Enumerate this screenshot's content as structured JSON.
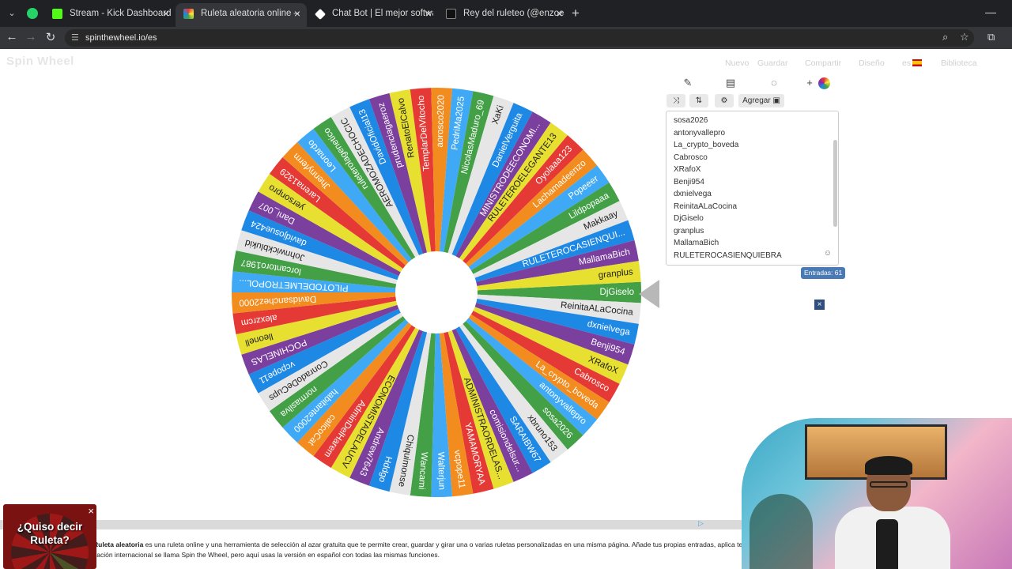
{
  "browser": {
    "tabs": [
      {
        "title": "Stream - Kick Dashboard",
        "favicon_color": "#53fc18"
      },
      {
        "title": "Ruleta aleatoria online – ruleta",
        "favicon_color": "#e53935"
      },
      {
        "title": "Chat Bot | El mejor software pa",
        "favicon_color": "#ffffff"
      },
      {
        "title": "Rey del ruleteo (@enzoeasycas",
        "favicon_color": "#111111"
      }
    ],
    "url": "spinthewheel.io/es"
  },
  "site": {
    "logo": "Spin Wheel",
    "menu": [
      "Nuevo",
      "Guardar",
      "Compartir",
      "Diseño",
      "es",
      "Biblioteca"
    ]
  },
  "wheel": {
    "colors": [
      "#43a047",
      "#e6e6e6",
      "#1e88e5",
      "#7b3f9e",
      "#e8e030",
      "#e53935",
      "#f28c1e",
      "#3fa9f5"
    ],
    "segments": [
      "DjGiselo",
      "ReinitaALaCocina",
      "dxnielvega",
      "Benji954",
      "XRafoX",
      "Cabrosco",
      "La_crypto_boveda",
      "antonyvallepro",
      "sosa2026",
      "xbruno153",
      "SARAIBW67",
      "comisiondelsur...",
      "ADMINISTRAORDELAS...",
      "YAMAMORYAA",
      "vcpope11",
      "Walterjun",
      "Wancami",
      "Chiquimonse",
      "Hddgo",
      "Andrew7643",
      "ECONOMISTADELAUCV",
      "AdminDelHarem",
      "calicoCat",
      "habitante2000",
      "normasilva",
      "ConradoDeCups",
      "vcpope11",
      "POCHINELAS",
      "lleonell",
      "alexzrcm",
      "Davidsanchez2000",
      "PILOTODELMETROPOL...",
      "lorcantoro1987",
      "Johnwickblukid",
      "davidjosue424",
      "Dani_007",
      "yersonpro",
      "Larena1329",
      "Jhennyferm",
      "Leonardo",
      "ruleterolagenetico",
      "AEROMOZADECHOCIC",
      "DavidOficial13",
      "prudenciagaeroz",
      "RenatoElCalvo",
      "TemplarDelVitocho",
      "aorosco2020",
      "PedriMa2025",
      "NicolasMaduro_69",
      "XaKi",
      "DanielVerguita",
      "MINISTRODEECONOMI...",
      "RULETEROELEGANTE13",
      "Oyolaaa123",
      "Lachamadeenzo",
      "Popeeer",
      "Lildpopaaa",
      "Makkaay",
      "RULETEROCASIENQUI...",
      "MallamaBich",
      "granplus"
    ]
  },
  "panel": {
    "tools": [
      "edit-icon",
      "list-icon",
      "hide-icon",
      "add-icon"
    ],
    "add_button": "Agregar",
    "entries": [
      "sosa2026",
      "antonyvallepro",
      "La_crypto_boveda",
      "Cabrosco",
      "XRafoX",
      "Benji954",
      "dxnielvega",
      "ReinitaALaCocina",
      "DjGiselo",
      "granplus",
      "MallamaBich",
      "RULETEROCASIENQUIEBRA"
    ],
    "count_label": "Entradas: 61"
  },
  "footer": {
    "description_bold": "Ruleta aleatoria",
    "description_line1": " es una ruleta online y una herramienta de selección al azar gratuita que te permite crear, guardar y girar una o varias ruletas personalizadas en una misma página. Añade tus propias entradas, aplica te",
    "description_line2": "cación internacional se llama Spin the Wheel, pero aquí usas la versión en español con todas las mismas funciones."
  },
  "promo": {
    "text_line1": "¿Quiso decir",
    "text_line2": "Ruleta?"
  }
}
